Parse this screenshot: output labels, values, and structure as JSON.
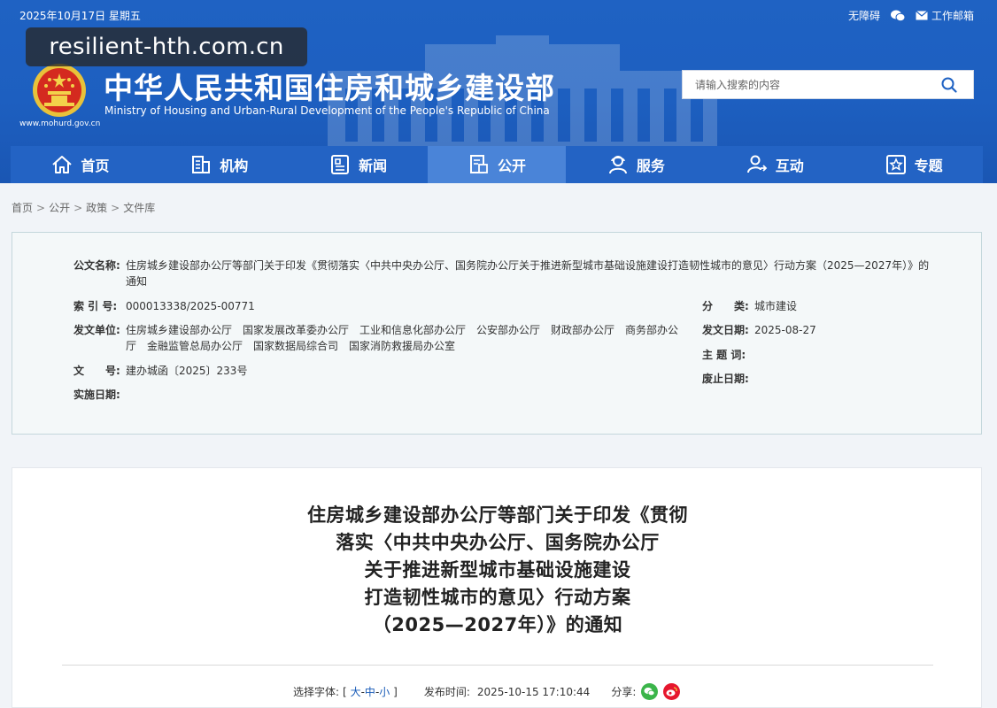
{
  "topbar": {
    "date": "2025年10月17日 星期五",
    "accessibility": "无障碍",
    "email": "工作邮箱"
  },
  "watermark": "resilient-hth.com.cn",
  "site": {
    "url": "www.mohurd.gov.cn",
    "title": "中华人民共和国住房和城乡建设部",
    "subtitle": "Ministry of Housing and Urban-Rural Development of the People's Republic of China"
  },
  "search": {
    "placeholder": "请输入搜索的内容"
  },
  "nav": {
    "items": [
      {
        "label": "首页",
        "icon": "home-icon"
      },
      {
        "label": "机构",
        "icon": "building-icon"
      },
      {
        "label": "新闻",
        "icon": "news-icon"
      },
      {
        "label": "公开",
        "icon": "disclosure-icon",
        "active": true
      },
      {
        "label": "服务",
        "icon": "service-icon"
      },
      {
        "label": "互动",
        "icon": "interaction-icon"
      },
      {
        "label": "专题",
        "icon": "topic-icon"
      }
    ]
  },
  "breadcrumb": [
    "首页",
    "公开",
    "政策",
    "文件库"
  ],
  "info": {
    "doc_name_label": "公文名称:",
    "doc_name_line1": "住房城乡建设部办公厅等部门关于印发《贯彻落实〈中共中央办公厅、国务院办公厅关于推进新型城市基础设施建设打造韧性城市的意见〉行动方案（2025—2027年）》的",
    "doc_name_line2": "通知",
    "index_label": "索 引 号:",
    "index_value": "000013338/2025-00771",
    "category_label": "分　　类:",
    "category_value": "城市建设",
    "issuer_label": "发文单位:",
    "issuer_line1": "住房城乡建设部办公厅　国家发展改革委办公厅　工业和信息化部办公厅　公安部办公厅　财政部办公厅　商务部办公",
    "issuer_line2": "厅　金融监管总局办公厅　国家数据局综合司　国家消防救援局办公室",
    "issue_date_label": "发文日期:",
    "issue_date_value": "2025-08-27",
    "docno_label": "文　　号:",
    "docno_value": "建办城函〔2025〕233号",
    "subject_label": "主 题 词:",
    "subject_value": "",
    "effective_label": "实施日期:",
    "effective_value": "",
    "abolish_label": "废止日期:",
    "abolish_value": ""
  },
  "article": {
    "title_lines": [
      "住房城乡建设部办公厅等部门关于印发《贯彻",
      "落实〈中共中央办公厅、国务院办公厅",
      "关于推进新型城市基础设施建设",
      "打造韧性城市的意见〉行动方案",
      "（2025—2027年）》的通知"
    ],
    "font_size_label": "选择字体:",
    "font_open": "[",
    "font_large": "大",
    "font_medium": "中",
    "font_small": "小",
    "font_close": "]",
    "dash": "-",
    "publish_label": "发布时间:",
    "publish_value": "2025-10-15 17:10:44",
    "share_label": "分享:"
  }
}
